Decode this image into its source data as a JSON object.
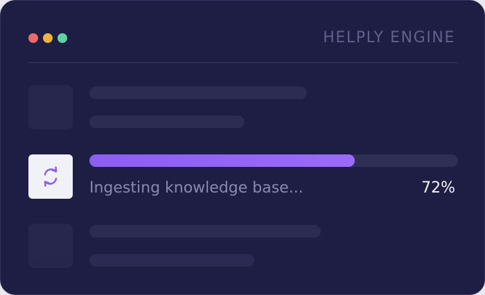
{
  "window": {
    "title": "HELPLY ENGINE",
    "traffic_lights": {
      "close_color": "#ec6a6a",
      "minimize_color": "#f0b43c",
      "maximize_color": "#5fd3a2"
    }
  },
  "task": {
    "icon": "refresh-icon",
    "status_text": "Ingesting knowledge base...",
    "progress_percent": 72,
    "progress_label": "72%",
    "accent_color": "#8c5ff2"
  },
  "placeholders": {
    "rows": 2,
    "style": "skeleton-loading"
  }
}
